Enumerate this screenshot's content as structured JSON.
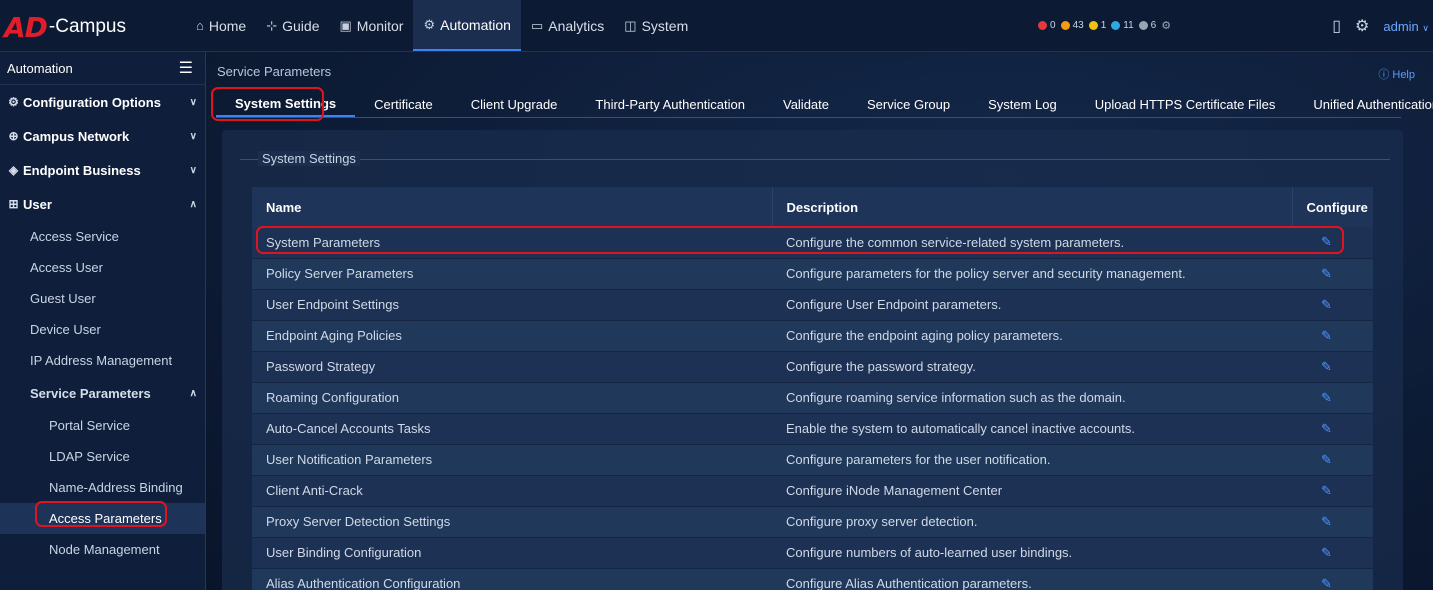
{
  "app": {
    "logo_ad": "AD",
    "logo_rest": "-Campus",
    "nav": [
      {
        "label": "Home",
        "icon": "home-icon"
      },
      {
        "label": "Guide",
        "icon": "guide-icon"
      },
      {
        "label": "Monitor",
        "icon": "monitor-icon"
      },
      {
        "label": "Automation",
        "icon": "automation-icon"
      },
      {
        "label": "Analytics",
        "icon": "analytics-icon"
      },
      {
        "label": "System",
        "icon": "system-icon"
      }
    ],
    "alarms": [
      {
        "count": "0",
        "color": "#e5383b"
      },
      {
        "count": "43",
        "color": "#f39c12"
      },
      {
        "count": "1",
        "color": "#f1c40f"
      },
      {
        "count": "11",
        "color": "#2ea8e0"
      },
      {
        "count": "6",
        "color": "#9aa5b4"
      }
    ],
    "user": "admin"
  },
  "sidebar": {
    "title": "Automation",
    "groups": [
      {
        "label": "Configuration Options",
        "icon": "gear-icon"
      },
      {
        "label": "Campus Network",
        "icon": "globe-icon"
      },
      {
        "label": "Endpoint Business",
        "icon": "shield-icon"
      },
      {
        "label": "User",
        "icon": "user-icon"
      }
    ],
    "user_items": [
      "Access Service",
      "Access User",
      "Guest User",
      "Device User",
      "IP Address Management"
    ],
    "service_parameters": {
      "label": "Service Parameters",
      "items": [
        "Portal Service",
        "LDAP Service",
        "Name-Address Binding",
        "Access Parameters",
        "Node Management"
      ]
    }
  },
  "main": {
    "breadcrumb": "Service Parameters",
    "help": "Help",
    "tabs": [
      "System Settings",
      "Certificate",
      "Client Upgrade",
      "Third-Party Authentication",
      "Validate",
      "Service Group",
      "System Log",
      "Upload HTTPS Certificate Files",
      "Unified Authentication"
    ],
    "section_title": "System Settings",
    "table": {
      "headers": [
        "Name",
        "Description",
        "Configure"
      ],
      "rows": [
        {
          "name": "System Parameters",
          "desc": "Configure the common service-related system parameters."
        },
        {
          "name": "Policy Server Parameters",
          "desc": "Configure parameters for the policy server and security management."
        },
        {
          "name": "User Endpoint Settings",
          "desc": "Configure User Endpoint parameters."
        },
        {
          "name": "Endpoint Aging Policies",
          "desc": "Configure the endpoint aging policy parameters."
        },
        {
          "name": "Password Strategy",
          "desc": "Configure the password strategy."
        },
        {
          "name": "Roaming Configuration",
          "desc": "Configure roaming service information such as the domain."
        },
        {
          "name": "Auto-Cancel Accounts Tasks",
          "desc": "Enable the system to automatically cancel inactive accounts."
        },
        {
          "name": "User Notification Parameters",
          "desc": "Configure parameters for the user notification."
        },
        {
          "name": "Client Anti-Crack",
          "desc": "Configure iNode Management Center"
        },
        {
          "name": "Proxy Server Detection Settings",
          "desc": "Configure proxy server detection."
        },
        {
          "name": "User Binding Configuration",
          "desc": "Configure numbers of auto-learned user bindings."
        },
        {
          "name": "Alias Authentication Configuration",
          "desc": "Configure Alias Authentication parameters."
        }
      ]
    }
  }
}
